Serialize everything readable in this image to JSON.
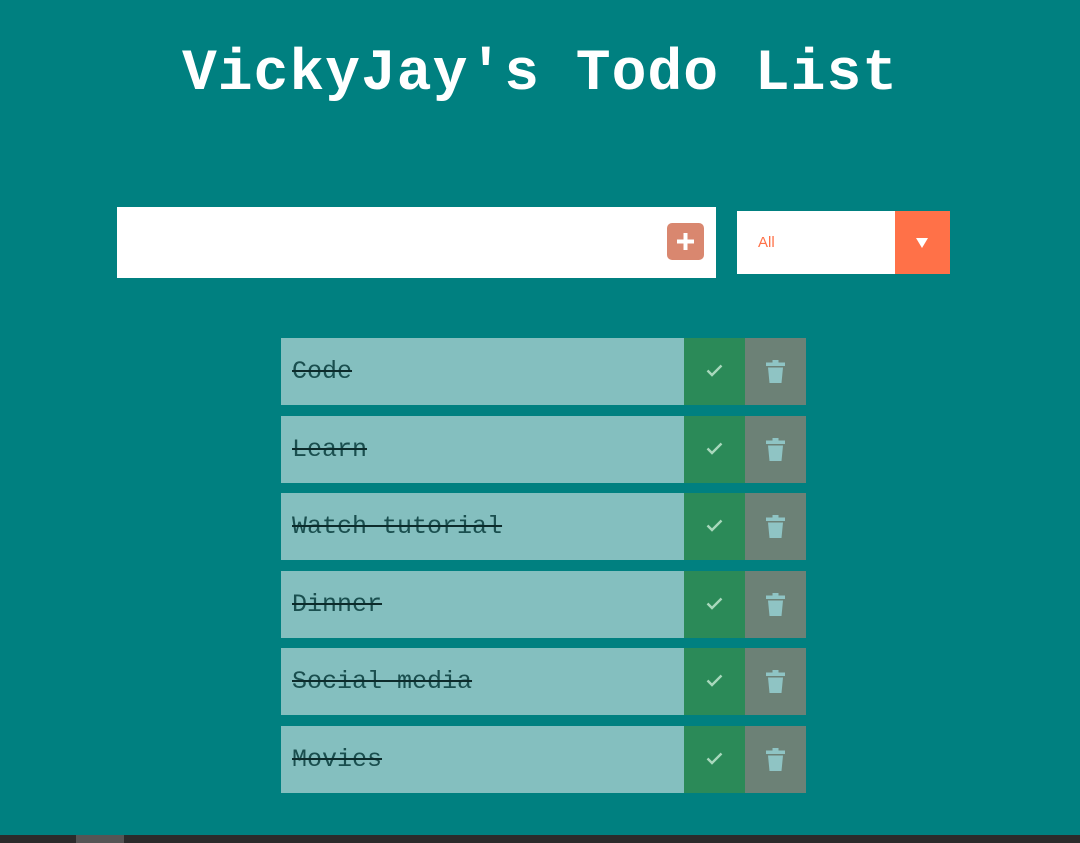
{
  "header": {
    "title": "VickyJay's Todo List"
  },
  "form": {
    "input_value": "",
    "input_placeholder": "",
    "add_icon": "plus-icon"
  },
  "filter": {
    "selected": "All",
    "arrow_icon": "caret-down-icon"
  },
  "todos": [
    {
      "text": "Code",
      "completed": true
    },
    {
      "text": "Learn",
      "completed": true
    },
    {
      "text": "Watch tutorial",
      "completed": true
    },
    {
      "text": "Dinner",
      "completed": true
    },
    {
      "text": "Social media",
      "completed": true
    },
    {
      "text": "Movies",
      "completed": true
    }
  ],
  "colors": {
    "background": "#008080",
    "accent": "#ff7148",
    "add_button": "#d9876f",
    "todo_item": "#84bfbf",
    "complete_button": "#2b8a58",
    "trash_button": "#6c8176"
  }
}
